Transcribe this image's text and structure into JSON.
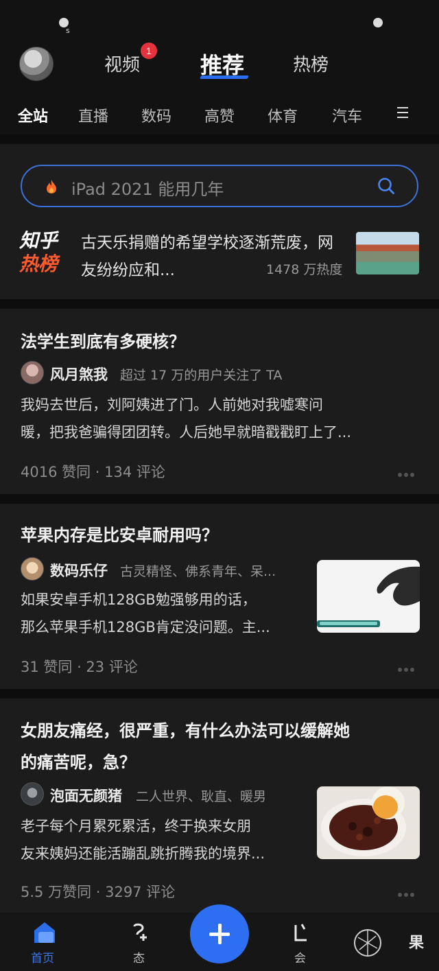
{
  "status": {
    "s_char": "s"
  },
  "top_tabs": {
    "video": "视频",
    "video_badge": "1",
    "recommend": "推荐",
    "hot": "热榜"
  },
  "channels": [
    "全站",
    "直播",
    "数码",
    "高赞",
    "体育",
    "汽车"
  ],
  "search": {
    "placeholder": "iPad 2021 能用几年"
  },
  "hot_list": {
    "logo_line1": "知乎",
    "logo_line2": "热榜",
    "title": "古天乐捐赠的希望学校逐渐荒废，网友纷纷应和...",
    "heat": "1478 万热度"
  },
  "feed": [
    {
      "title": "法学生到底有多硬核？",
      "author": "风月煞我",
      "author_desc": "超过 17 万的用户关注了 TA",
      "excerpt_line1": "我妈去世后，刘阿姨进了门。人前她对我嘘寒问",
      "excerpt_line2": "暖，把我爸骗得团团转。人后她早就暗戳戳盯上了...",
      "stats": "4016 赞同 · 134 评论"
    },
    {
      "title": "苹果内存是比安卓耐用吗？",
      "author": "数码乐仔",
      "author_desc": "古灵精怪、佛系青年、呆...",
      "excerpt_line1": "如果安卓手机128GB勉强够用的话，",
      "excerpt_line2": "那么苹果手机128GB肯定没问题。主...",
      "stats": "31 赞同 · 23 评论"
    },
    {
      "title_line1": "女朋友痛经，很严重，有什么办法可以缓解她",
      "title_line2": "的痛苦呢，急？",
      "author": "泡面无颜猪",
      "author_desc": "二人世界、耿直、暖男",
      "excerpt_line1": "老子每个月累死累活，终于换来女朋",
      "excerpt_line2": "友来姨妈还能活蹦乱跳折腾我的境界...",
      "stats": "5.5 万赞同 · 3297 评论"
    }
  ],
  "bottom_nav": {
    "home": "首页",
    "dynamic_partial": "态",
    "member_partial": "会",
    "watermark_char": "果"
  },
  "colors": {
    "accent": "#2e6ff2",
    "badge": "#e5333d",
    "hot_orange": "#ff5a2e"
  }
}
